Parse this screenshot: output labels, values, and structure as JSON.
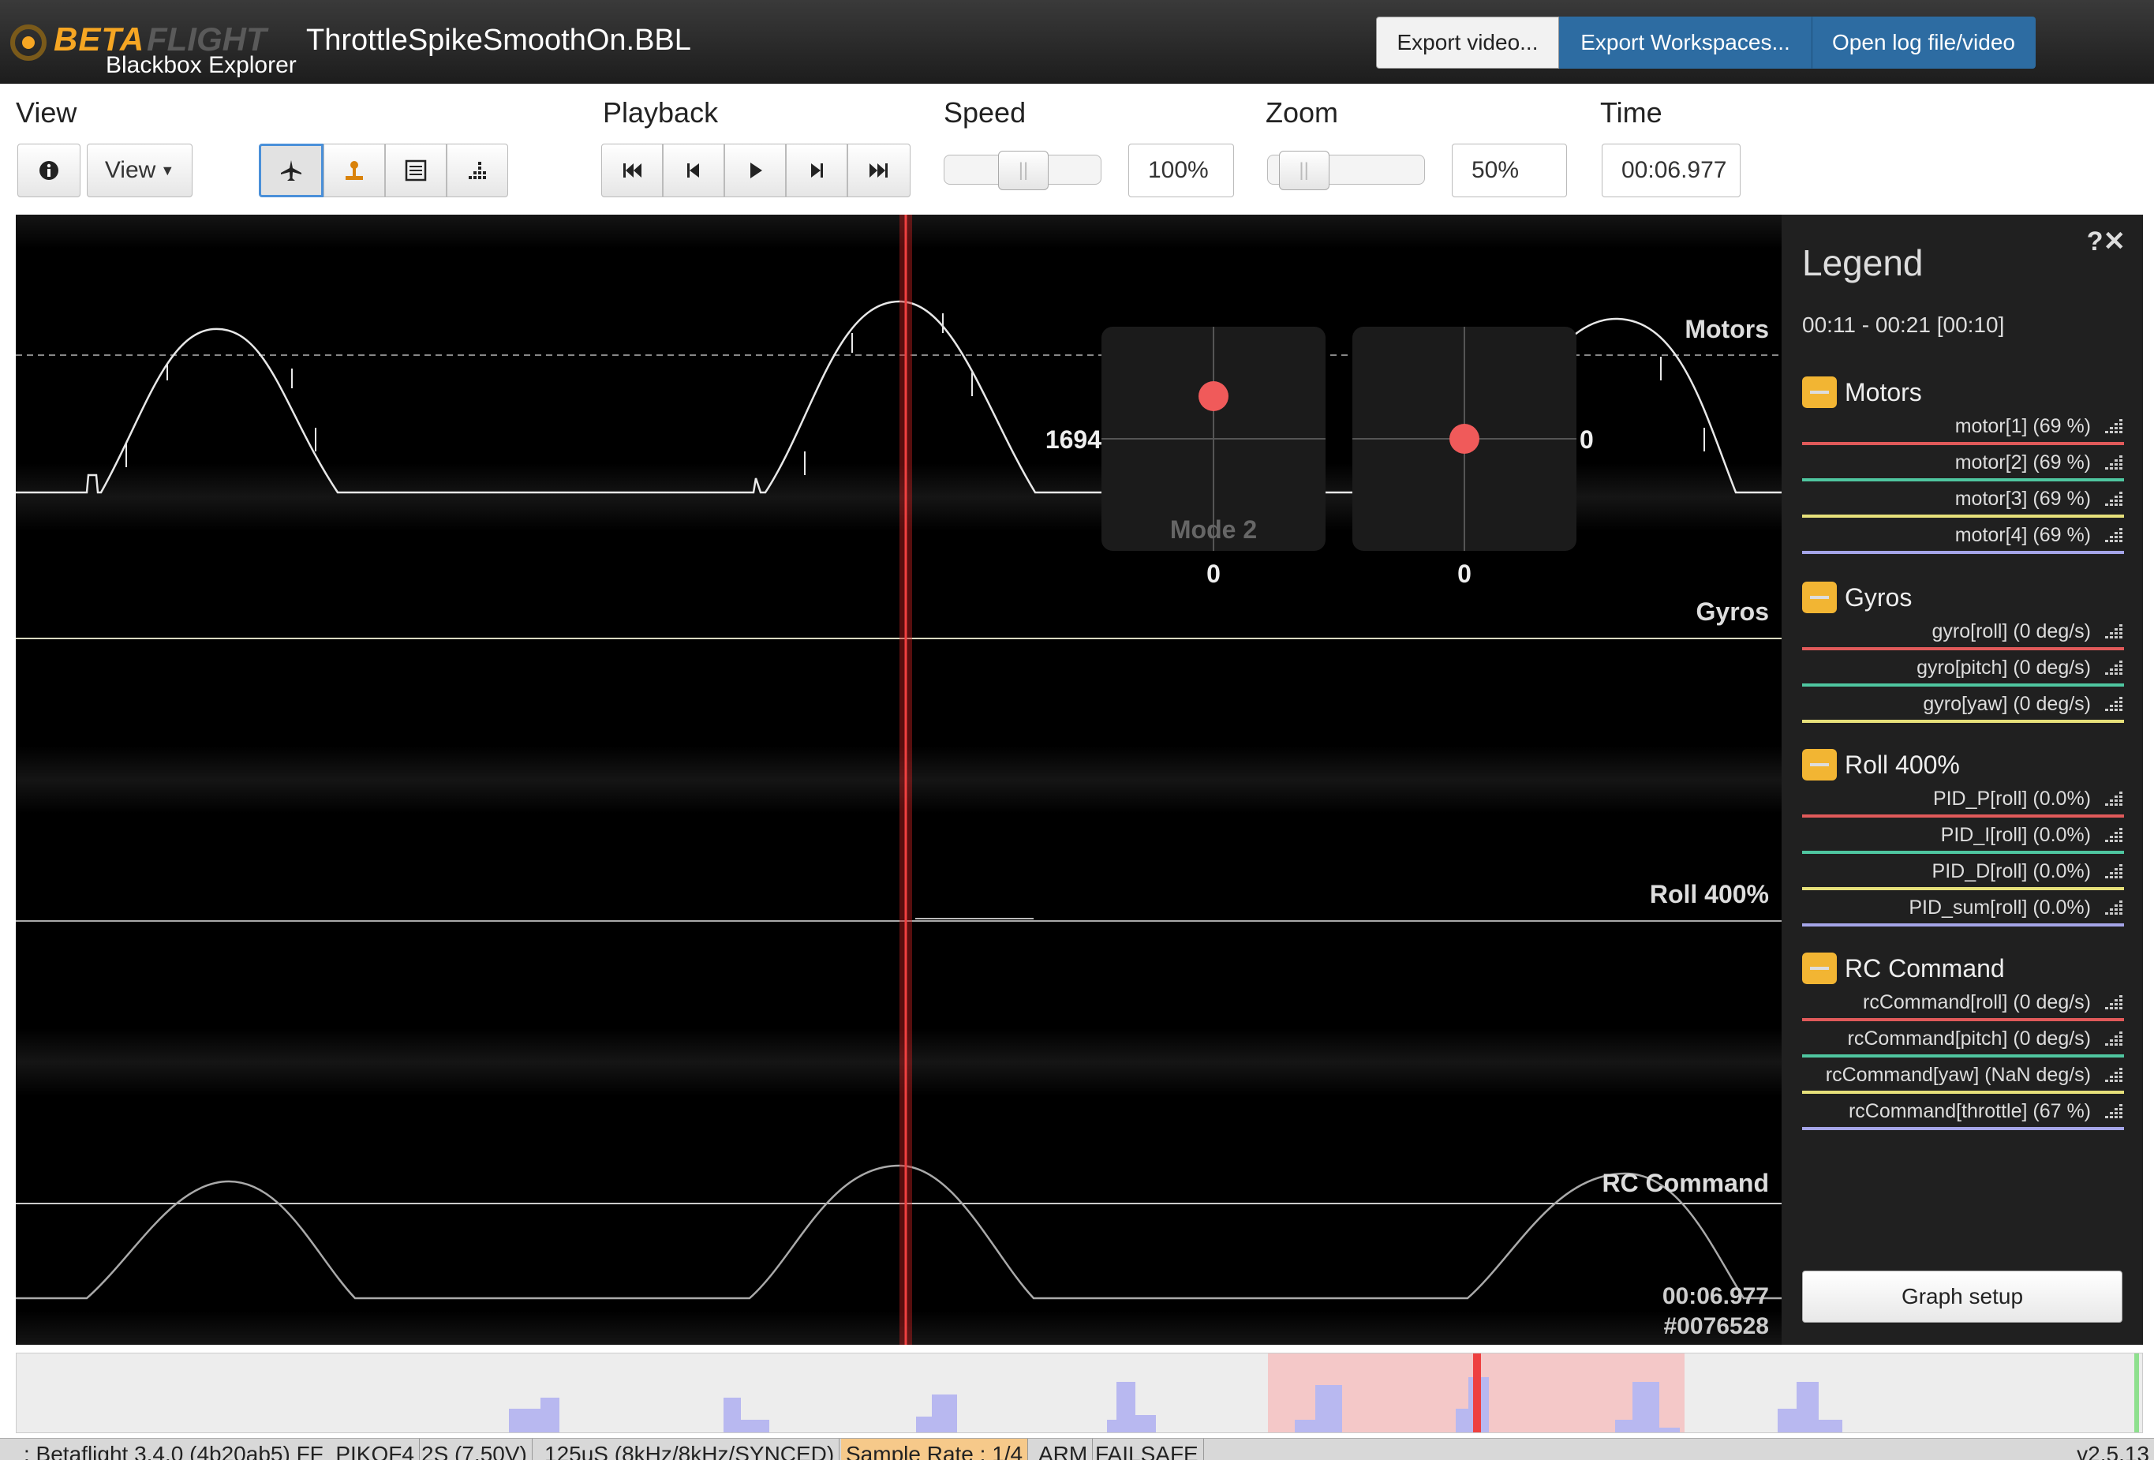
{
  "header": {
    "brand_beta": "BETA",
    "brand_flight": "FLIGHT",
    "brand_app": "Blackbox Explorer",
    "filename": "ThrottleSpikeSmoothOn.BBL",
    "export_video_label": "Export video...",
    "export_workspaces_label": "Export Workspaces...",
    "open_log_label": "Open log file/video"
  },
  "toolbar": {
    "view_title": "View",
    "view_dropdown_label": "View",
    "playback_title": "Playback",
    "speed_title": "Speed",
    "speed_value": "100%",
    "speed_fraction": 0.5,
    "zoom_title": "Zoom",
    "zoom_value": "50%",
    "zoom_fraction": 0.1,
    "time_title": "Time",
    "time_value": "00:06.977"
  },
  "graph": {
    "labels": {
      "motors": "Motors",
      "gyros": "Gyros",
      "roll": "Roll 400%",
      "rc": "RC Command"
    },
    "stick_left_value": "1694",
    "stick_left_bottom": "0",
    "stick_right_value": "0",
    "stick_right_bottom": "0",
    "stick_mode": "Mode 2",
    "cursor_time": "00:06.977",
    "cursor_frame": "#0076528"
  },
  "legend": {
    "title": "Legend",
    "range": "00:11 - 00:21 [00:10]",
    "groups": [
      {
        "name": "Motors",
        "rows": [
          "motor[1] (69 %)",
          "motor[2] (69 %)",
          "motor[3] (69 %)",
          "motor[4] (69 %)"
        ]
      },
      {
        "name": "Gyros",
        "rows": [
          "gyro[roll] (0 deg/s)",
          "gyro[pitch] (0 deg/s)",
          "gyro[yaw] (0 deg/s)"
        ]
      },
      {
        "name": "Roll 400%",
        "rows": [
          "PID_P[roll] (0.0%)",
          "PID_I[roll] (0.0%)",
          "PID_D[roll] (0.0%)",
          "PID_sum[roll] (0.0%)"
        ]
      },
      {
        "name": "RC Command",
        "rows": [
          "rcCommand[roll] (0 deg/s)",
          "rcCommand[pitch] (0 deg/s)",
          "rcCommand[yaw] (NaN deg/s)",
          "rcCommand[throttle] (67 %)"
        ]
      }
    ],
    "series_colors": [
      "#e05a5a",
      "#4fc6a0",
      "#e6e07a",
      "#a5a5e8"
    ],
    "graph_setup_label": "Graph setup"
  },
  "status": {
    "firmware": ": Betaflight 3.4.0 (4b20ab5) FF_PIKOF4",
    "battery": "2S (7.50V)",
    "looptime": "125uS (8kHz/8kHz/SYNCED)",
    "sample_rate": "Sample Rate : 1/4",
    "arm": "ARM",
    "failsafe": "FAILSAFE",
    "version": "v2.5.13"
  },
  "colors": {
    "accent": "#2d6ca2",
    "legend_toggle": "#f2b533",
    "cursor": "#e03030"
  }
}
